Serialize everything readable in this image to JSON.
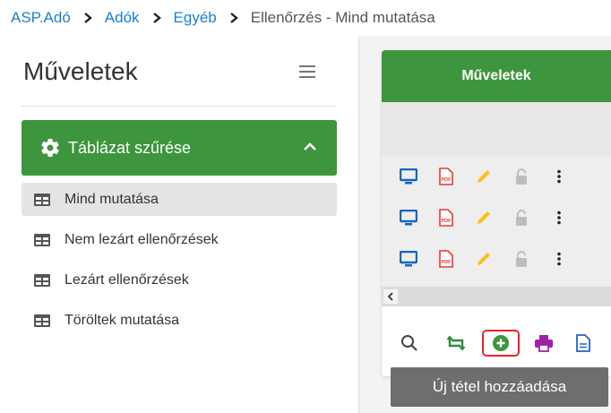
{
  "breadcrumb": {
    "items": [
      "ASP.Adó",
      "Adók",
      "Egyéb"
    ],
    "current": "Ellenőrzés - Mind mutatása"
  },
  "sidebar": {
    "title": "Műveletek",
    "filter_button": "Táblázat szűrése",
    "items": [
      {
        "label": "Mind mutatása",
        "active": true
      },
      {
        "label": "Nem lezárt ellenőrzések",
        "active": false
      },
      {
        "label": "Lezárt ellenőrzések",
        "active": false
      },
      {
        "label": "Töröltek mutatása",
        "active": false
      }
    ]
  },
  "panel": {
    "header": "Műveletek",
    "row_count": 3,
    "row_icons": [
      "monitor-icon",
      "pdf-icon",
      "pencil-icon",
      "unlock-icon",
      "more-vertical-icon"
    ],
    "toolbar_icons": [
      "search-icon",
      "refresh-icon",
      "add-icon",
      "print-icon",
      "document-icon"
    ]
  },
  "tooltip": {
    "text": "Új tétel hozzáadása"
  },
  "colors": {
    "green": "#3d953e",
    "link_blue": "#1a7fd0",
    "monitor_blue": "#1565c0",
    "pdf_red": "#e53935",
    "pencil_yellow": "#f9c01a",
    "print_purple": "#a020a8",
    "doc_blue": "#2463c8",
    "highlight_red": "#e8242c"
  }
}
